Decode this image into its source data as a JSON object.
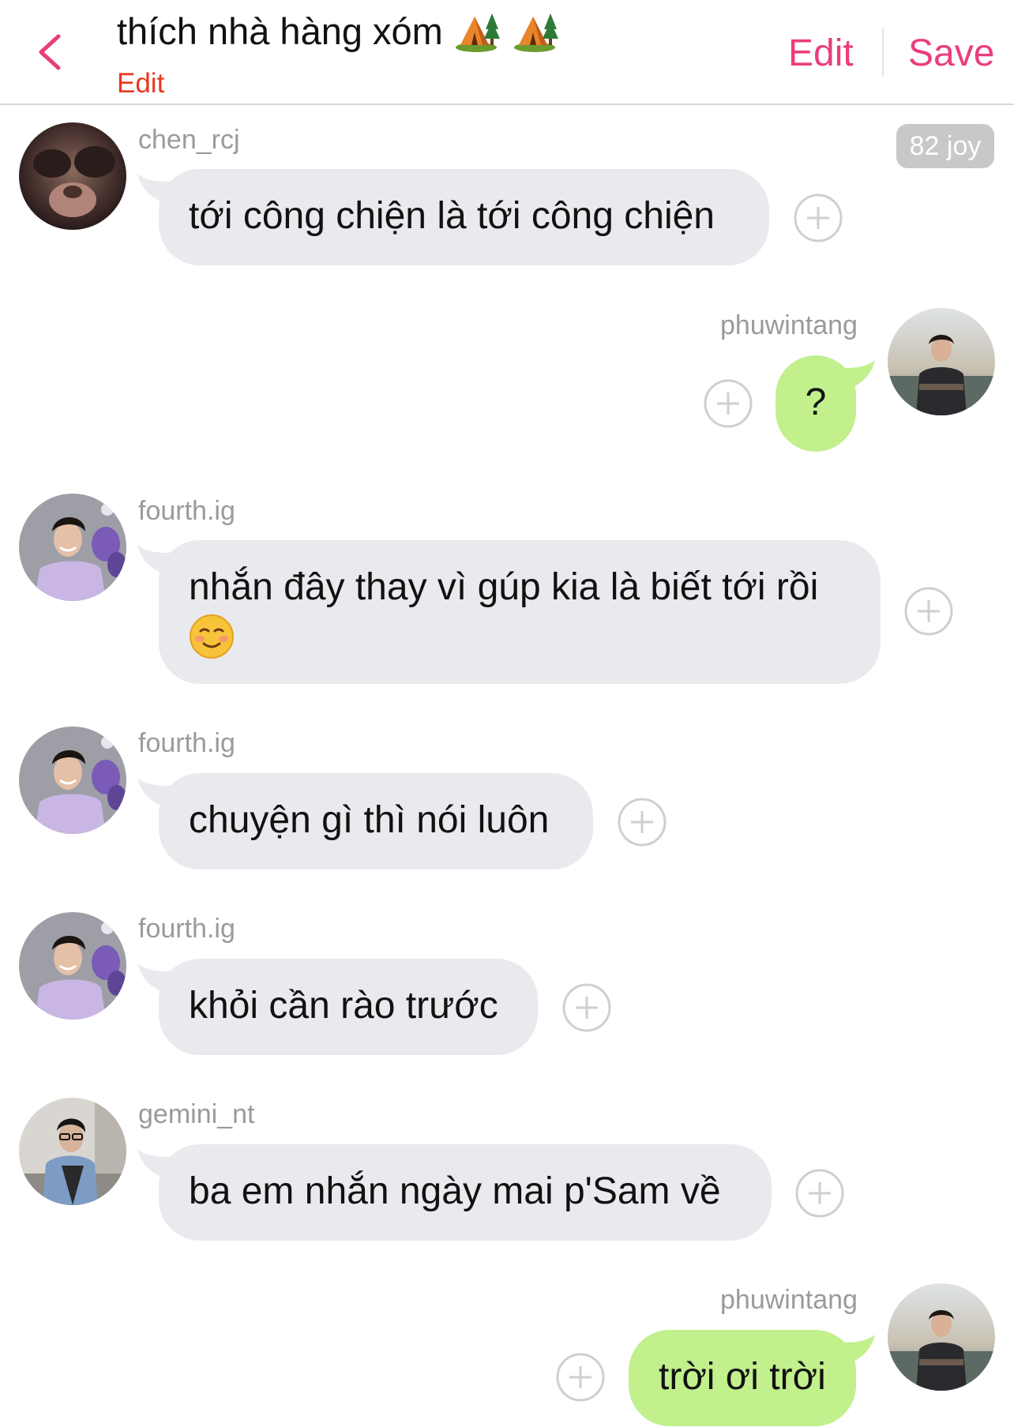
{
  "header": {
    "title": "thích nhà hàng xóm",
    "title_icons": [
      "camping-tent-icon",
      "camping-tent-icon"
    ],
    "title_edit_label": "Edit",
    "edit_label": "Edit",
    "save_label": "Save",
    "back_icon": "chevron-left-icon"
  },
  "colors": {
    "accent": "#ea3d7d",
    "title_edit": "#e8381f",
    "bubble_other": "#e9eaed",
    "bubble_mine": "#c1f08c",
    "username": "#9a9a9a"
  },
  "messages": [
    {
      "username": "chen_rcj",
      "text": "tới công chiện là tới công chiện",
      "side": "left",
      "badge": "82 joy"
    },
    {
      "username": "phuwintang",
      "text": "?",
      "side": "right"
    },
    {
      "username": "fourth.ig",
      "text": "nhắn đây thay vì gúp kia là biết tới rồi",
      "emoji": "smiling-face-icon",
      "side": "left"
    },
    {
      "username": "fourth.ig",
      "text": "chuyện gì thì nói luôn",
      "side": "left"
    },
    {
      "username": "fourth.ig",
      "text": "khỏi cần rào trước",
      "side": "left"
    },
    {
      "username": "gemini_nt",
      "text": "ba em nhắn ngày mai p'Sam về",
      "side": "left"
    },
    {
      "username": "phuwintang",
      "text": "trời ơi trời",
      "side": "right"
    }
  ]
}
